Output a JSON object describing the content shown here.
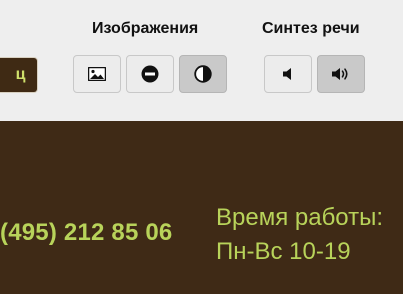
{
  "toolbar": {
    "color_scheme_label": "ц",
    "images_title": "Изображения",
    "speech_title": "Синтез речи",
    "buttons": {
      "images_on": {
        "icon": "image-icon",
        "active": false
      },
      "images_off": {
        "icon": "no-entry-icon",
        "active": false
      },
      "images_grayscale": {
        "icon": "contrast-icon",
        "active": true
      },
      "speech_off": {
        "icon": "speaker-mute-icon",
        "active": false
      },
      "speech_on": {
        "icon": "speaker-volume-icon",
        "active": true
      }
    }
  },
  "contact": {
    "phone": "(495) 212 85 06",
    "hours_title": "Время работы:",
    "hours_value": "Пн-Вс 10-19"
  },
  "colors": {
    "toolbar_bg": "#eeeeee",
    "dark_bg": "#3f2a16",
    "accent_green": "#b8d35a",
    "active_button": "#c9c9c9"
  }
}
